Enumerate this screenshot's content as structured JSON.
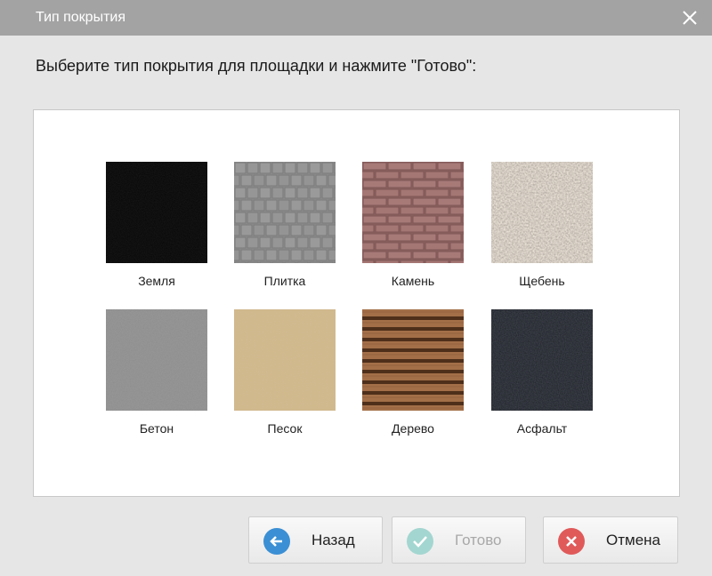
{
  "window": {
    "title": "Тип покрытия",
    "close_icon": "close-icon"
  },
  "prompt": "Выберите тип покрытия для площадки и нажмите \"Готово\":",
  "surfaces": [
    {
      "label": "Земля",
      "texture": "black-soil"
    },
    {
      "label": "Плитка",
      "texture": "gray-paving-tiles"
    },
    {
      "label": "Камень",
      "texture": "brick-stone"
    },
    {
      "label": "Щебень",
      "texture": "gravel"
    },
    {
      "label": "Бетон",
      "texture": "concrete"
    },
    {
      "label": "Песок",
      "texture": "sand"
    },
    {
      "label": "Дерево",
      "texture": "wood-planks"
    },
    {
      "label": "Асфальт",
      "texture": "asphalt"
    }
  ],
  "buttons": {
    "back": {
      "label": "Назад",
      "icon": "arrow-left-icon",
      "color": "#3b8fd4"
    },
    "done": {
      "label": "Готово",
      "icon": "check-icon",
      "color": "#a3d6d0",
      "disabled": true
    },
    "cancel": {
      "label": "Отмена",
      "icon": "x-circle-icon",
      "color": "#e05a5a"
    }
  }
}
